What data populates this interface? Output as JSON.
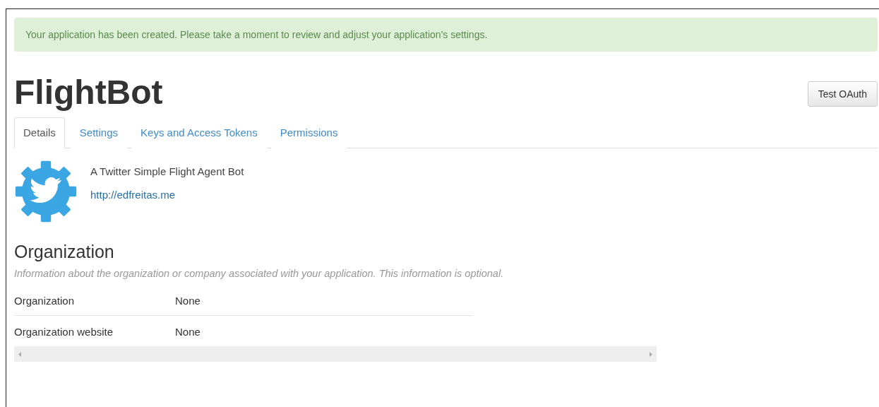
{
  "alert": "Your application has been created. Please take a moment to review and adjust your application's settings.",
  "app": {
    "name": "FlightBot",
    "description": "A Twitter Simple Flight Agent Bot",
    "website": "http://edfreitas.me"
  },
  "actions": [
    "Test OAuth"
  ],
  "tabs": [
    {
      "label": "Details",
      "selected": true
    },
    {
      "label": "Settings",
      "selected": false
    },
    {
      "label": "Keys and Access Tokens",
      "selected": false
    },
    {
      "label": "Permissions",
      "selected": false
    }
  ],
  "organization": {
    "heading": "Organization",
    "note": "Information about the organization or company associated with your application. This information is optional.",
    "rows": [
      {
        "label": "Organization",
        "value": "None"
      },
      {
        "label": "Organization website",
        "value": "None"
      }
    ]
  }
}
